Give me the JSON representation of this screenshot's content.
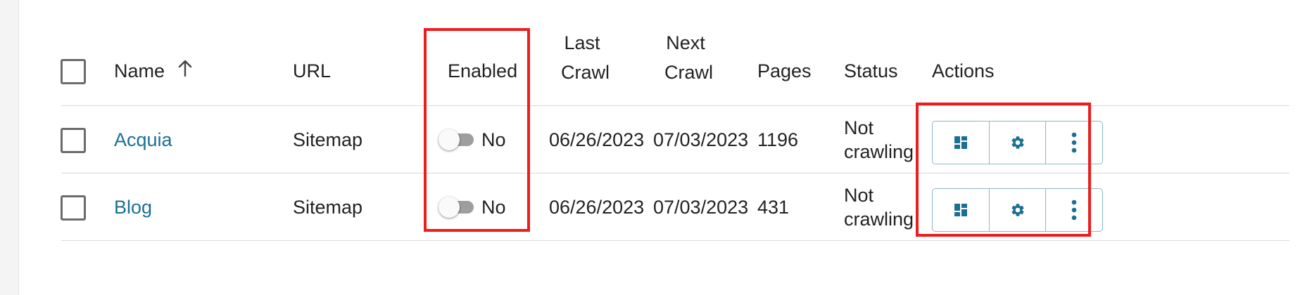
{
  "table": {
    "headers": {
      "name": "Name",
      "url": "URL",
      "enabled": "Enabled",
      "last_crawl_line1": "Last",
      "last_crawl_line2": "Crawl",
      "next_crawl_line1": "Next",
      "next_crawl_line2": "Crawl",
      "pages": "Pages",
      "status": "Status",
      "actions": "Actions"
    },
    "rows": [
      {
        "name": "Acquia",
        "url": "Sitemap",
        "enabled_label": "No",
        "last_crawl": "06/26/2023",
        "next_crawl": "07/03/2023",
        "pages": "1196",
        "status_line1": "Not",
        "status_line2": "crawling"
      },
      {
        "name": "Blog",
        "url": "Sitemap",
        "enabled_label": "No",
        "last_crawl": "06/26/2023",
        "next_crawl": "07/03/2023",
        "pages": "431",
        "status_line1": "Not",
        "status_line2": "crawling"
      }
    ]
  },
  "icons": {
    "sort": "arrow-up-icon",
    "dashboard": "dashboard-icon",
    "settings": "gear-icon",
    "more": "more-vertical-icon"
  },
  "colors": {
    "link": "#1b6f93",
    "icon": "#1b6f93",
    "highlight": "#ee1c1c",
    "toggle_off": "#9e9e9e",
    "button_border": "#8fb5c8"
  }
}
